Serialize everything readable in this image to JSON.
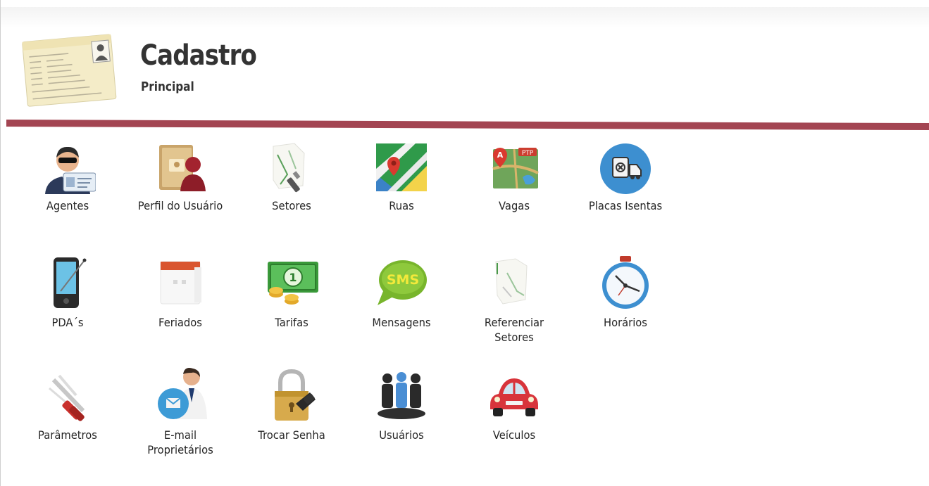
{
  "header": {
    "title": "Cadastro",
    "subtitle": "Principal",
    "icon": "id-card-icon"
  },
  "colors": {
    "divider": "#a34552",
    "background": "#ffffff",
    "text": "#262626"
  },
  "menu": {
    "row1": [
      {
        "label": "Agentes",
        "icon": "agent-badge-icon"
      },
      {
        "label": "Perfil do Usuário",
        "icon": "user-profile-icon"
      },
      {
        "label": "Setores",
        "icon": "sectors-map-icon"
      },
      {
        "label": "Ruas",
        "icon": "streets-map-icon"
      },
      {
        "label": "Vagas",
        "icon": "parking-spots-map-icon"
      },
      {
        "label": "Placas Isentas",
        "icon": "exempt-plates-icon"
      }
    ],
    "row2": [
      {
        "label": "PDA´s",
        "icon": "pda-device-icon"
      },
      {
        "label": "Feriados",
        "icon": "calendar-icon"
      },
      {
        "label": "Tarifas",
        "icon": "money-icon"
      },
      {
        "label": "Mensagens",
        "icon": "sms-icon"
      },
      {
        "label": "Referenciar Setores",
        "icon": "reference-map-icon"
      },
      {
        "label": "Horários",
        "icon": "stopwatch-icon"
      }
    ],
    "row3": [
      {
        "label": "Parâmetros",
        "icon": "tools-icon"
      },
      {
        "label": "E-mail Proprietários",
        "icon": "email-owner-icon"
      },
      {
        "label": "Trocar Senha",
        "icon": "padlock-key-icon"
      },
      {
        "label": "Usuários",
        "icon": "users-group-icon"
      },
      {
        "label": "Veículos",
        "icon": "car-icon"
      }
    ]
  }
}
